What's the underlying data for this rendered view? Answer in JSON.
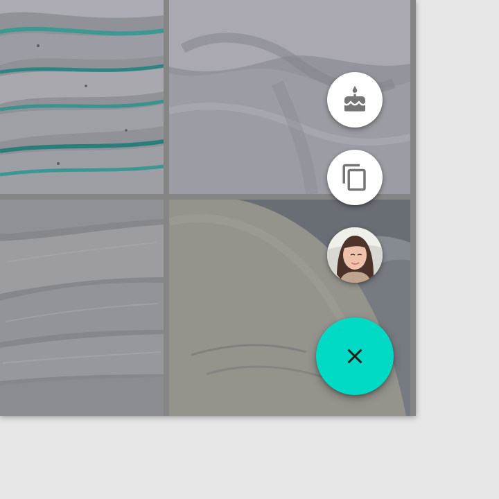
{
  "background_color": "#e6e6e6",
  "screen_color": "#8e8e8e",
  "accent_color": "#00d9c4",
  "fab_icon_color": "#757575",
  "photos": [
    {
      "name": "aerial-snow-water",
      "icon": "landscape-photo"
    },
    {
      "name": "ice-formation",
      "icon": "landscape-photo"
    },
    {
      "name": "sand-dunes",
      "icon": "landscape-photo"
    },
    {
      "name": "rock-boulders",
      "icon": "landscape-photo"
    }
  ],
  "speed_dial": {
    "actions": [
      {
        "icon": "cake-icon"
      },
      {
        "icon": "copy-icon"
      },
      {
        "icon": "avatar"
      }
    ],
    "main_icon": "close-icon"
  }
}
